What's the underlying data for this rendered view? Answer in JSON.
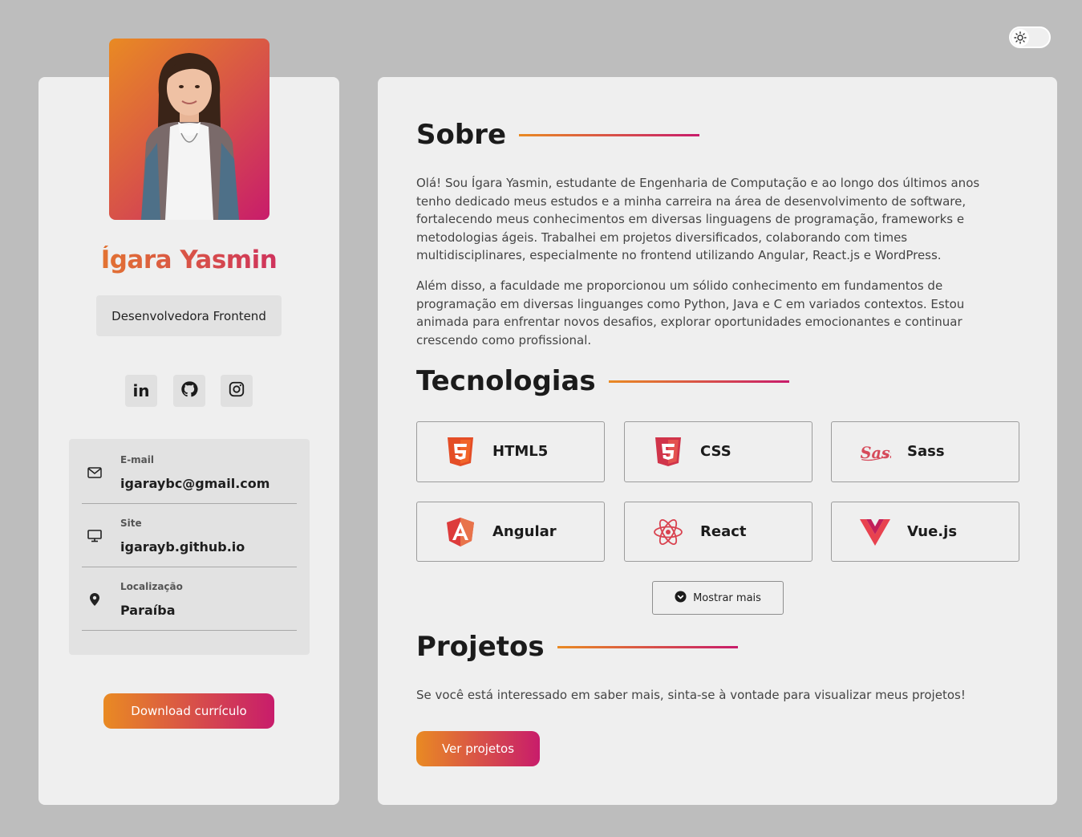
{
  "theme_toggle": {
    "icon": "sun-icon"
  },
  "profile": {
    "name": "Ígara Yasmin",
    "role": "Desenvolvedora Frontend",
    "photo_icon": "profile-photo"
  },
  "social": [
    {
      "name": "linkedin",
      "label": "in"
    },
    {
      "name": "github",
      "icon": "github-icon"
    },
    {
      "name": "instagram",
      "icon": "instagram-icon"
    }
  ],
  "contacts": [
    {
      "icon": "mail-icon",
      "label": "E-mail",
      "value": "igaraybc@gmail.com"
    },
    {
      "icon": "monitor-icon",
      "label": "Site",
      "value": "igarayb.github.io"
    },
    {
      "icon": "location-pin-icon",
      "label": "Localização",
      "value": "Paraíba"
    }
  ],
  "download_button": "Download currículo",
  "about": {
    "title": "Sobre",
    "paragraphs": [
      "Olá! Sou Ígara Yasmin, estudante de Engenharia de Computação e ao longo dos últimos anos tenho dedicado meus estudos e a minha carreira na área de desenvolvimento de software, fortalecendo meus conhecimentos em diversas linguagens de programação, frameworks e metodologias ágeis. Trabalhei em projetos diversificados, colaborando com times multidisciplinares, especialmente no frontend utilizando Angular, React.js e WordPress.",
      "Além disso, a faculdade me proporcionou um sólido conhecimento em fundamentos de programação em diversas linguanges como Python, Java e C em variados contextos. Estou animada para enfrentar novos desafios, explorar oportunidades emocionantes e continuar crescendo como profissional."
    ]
  },
  "technologies": {
    "title": "Tecnologias",
    "items": [
      {
        "name": "HTML5",
        "icon": "html5-icon"
      },
      {
        "name": "CSS",
        "icon": "css3-icon"
      },
      {
        "name": "Sass",
        "icon": "sass-icon"
      },
      {
        "name": "Angular",
        "icon": "angular-icon"
      },
      {
        "name": "React",
        "icon": "react-icon"
      },
      {
        "name": "Vue.js",
        "icon": "vue-icon"
      }
    ],
    "show_more": "Mostrar mais"
  },
  "projects": {
    "title": "Projetos",
    "text": "Se você está interessado em saber mais, sinta-se à vontade para visualizar meus projetos!",
    "button": "Ver projetos"
  }
}
